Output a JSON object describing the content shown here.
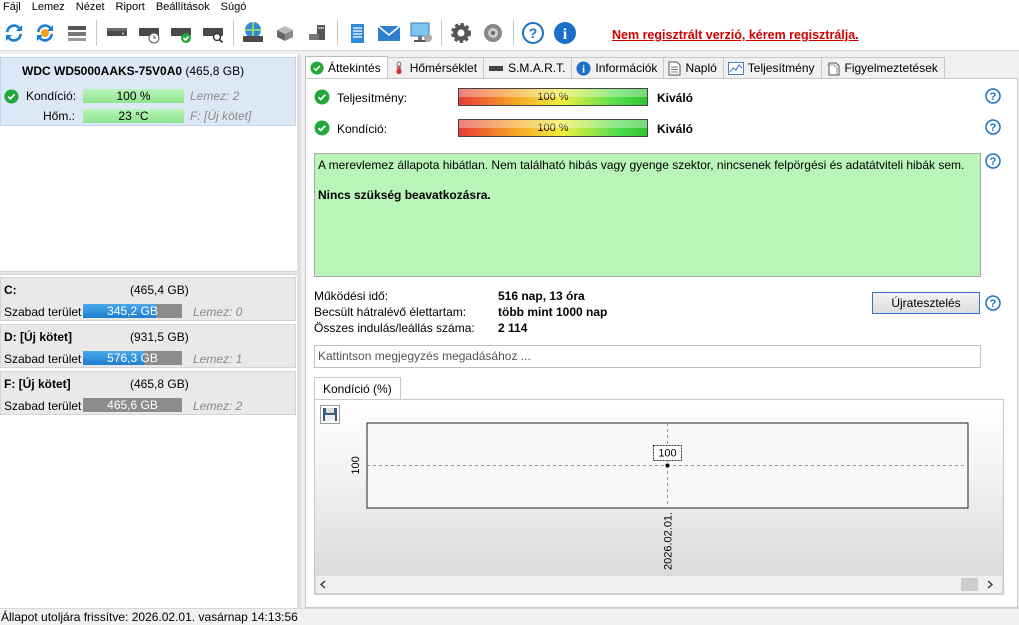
{
  "menu": [
    "Fájl",
    "Lemez",
    "Nézet",
    "Riport",
    "Beállítások",
    "Súgó"
  ],
  "toolbar": {
    "icons": [
      "refresh-icon",
      "refresh-all-icon",
      "drive-list-icon",
      "drive-icon",
      "drive-schedule-icon",
      "drive-check-icon",
      "drive-search-icon",
      "network-drive-icon",
      "server-drive-icon",
      "remote-drive-icon",
      "notes-icon",
      "email-icon",
      "network-icon",
      "settings-icon",
      "sound-icon",
      "help-icon",
      "info-icon"
    ],
    "register_link": "Nem regisztrált verzió, kérem regisztrálja."
  },
  "disk": {
    "model": "WDC WD5000AAKS-75V0A0",
    "size": "(465,8 GB)",
    "health_label": "Kondíció:",
    "health_value": "100 %",
    "health_disk": "Lemez: 2",
    "temp_label": "Hőm.:",
    "temp_value": "23 °C",
    "temp_volume": "F: [Új kötet]"
  },
  "volumes": [
    {
      "name": "C:",
      "size": "(465,4 GB)",
      "free_label": "Szabad terület",
      "free": "345,2 GB",
      "free_fraction": 0.74,
      "disk": "Lemez: 0"
    },
    {
      "name": "D: [Új kötet]",
      "size": "(931,5 GB)",
      "free_label": "Szabad terület",
      "free": "576,3 GB",
      "free_fraction": 0.62,
      "disk": "Lemez: 1"
    },
    {
      "name": "F: [Új kötet]",
      "size": "(465,8 GB)",
      "free_label": "Szabad terület",
      "free": "465,6 GB",
      "free_fraction": 1.0,
      "disk": "Lemez: 2"
    }
  ],
  "tabs": [
    {
      "label": "Áttekintés",
      "icon": "check-circle-icon"
    },
    {
      "label": "Hőmérséklet",
      "icon": "thermometer-icon"
    },
    {
      "label": "S.M.A.R.T.",
      "icon": "drive-icon"
    },
    {
      "label": "Információk",
      "icon": "info-icon"
    },
    {
      "label": "Napló",
      "icon": "log-icon"
    },
    {
      "label": "Teljesítmény",
      "icon": "performance-chart-icon"
    },
    {
      "label": "Figyelmeztetések",
      "icon": "alerts-icon"
    }
  ],
  "overview": {
    "performance_label": "Teljesítmény:",
    "performance_value": "100 %",
    "performance_rating": "Kiváló",
    "health_label": "Kondíció:",
    "health_value": "100 %",
    "health_rating": "Kiváló",
    "message": "A merevlemez állapota hibátlan. Nem található hibás vagy gyenge szektor, nincsenek felpörgési és adatátviteli hibák sem.",
    "message_action": "Nincs szükség beavatkozásra.",
    "power_on_label": "Működési idő:",
    "power_on_value": "516 nap, 13 óra",
    "lifetime_label": "Becsült hátralévő élettartam:",
    "lifetime_value": "több mint 1000 nap",
    "start_stop_label": "Összes indulás/leállás száma:",
    "start_stop_value": "2 114",
    "retest_button": "Újratesztelés",
    "note_placeholder": "Kattintson megjegyzés megadásához ...",
    "chart_tab": "Kondíció  (%)"
  },
  "chart_data": {
    "type": "line",
    "x": [
      "2026.02.01."
    ],
    "series": [
      {
        "values": [
          100
        ]
      }
    ],
    "ylim": [
      100,
      100
    ],
    "y_tick_labels": [
      "100"
    ],
    "x_tick_labels": [
      "2026.02.01."
    ],
    "point_labels": [
      "100"
    ],
    "grid": true
  },
  "status_bar": "Állapot utoljára frissítve: 2026.02.01. vasárnap 14:13:56"
}
